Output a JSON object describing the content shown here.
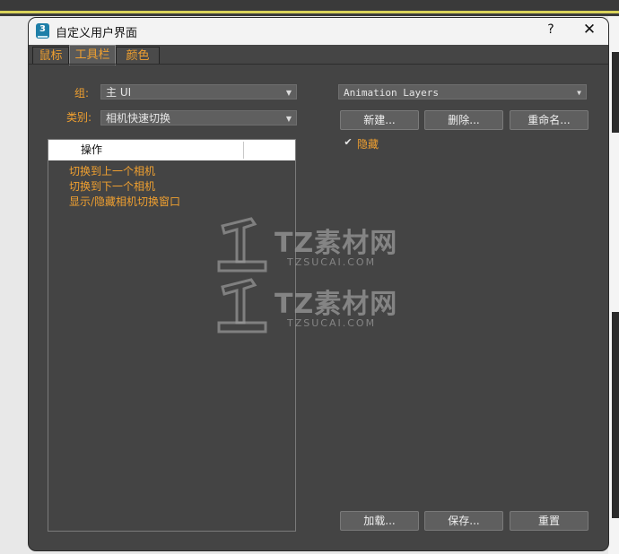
{
  "window": {
    "title": "自定义用户界面",
    "help_label": "?",
    "close_label": "✕"
  },
  "tabs": [
    {
      "label": "鼠标",
      "active": false
    },
    {
      "label": "工具栏",
      "active": true
    },
    {
      "label": "颜色",
      "active": false
    }
  ],
  "left": {
    "group_label": "组:",
    "group_value": "主 UI",
    "category_label": "类别:",
    "category_value": "相机快速切换",
    "list_header": "操作",
    "list_items": [
      "切换到上一个相机",
      "切换到下一个相机",
      "显示/隐藏相机切换窗口"
    ]
  },
  "right": {
    "toolbar_value": "Animation Layers",
    "new_button": "新建...",
    "delete_button": "删除...",
    "rename_button": "重命名...",
    "hide_checkbox_checked": true,
    "hide_label": "隐藏"
  },
  "bottom": {
    "load_button": "加载...",
    "save_button": "保存...",
    "reset_button": "重置"
  },
  "watermark": {
    "text": "TZ素材网",
    "sub": "TZSUCAI.COM"
  },
  "colors": {
    "accent_orange": "#f0a030",
    "dialog_bg": "#444444",
    "titlebar_bg": "#f3f3f3"
  }
}
